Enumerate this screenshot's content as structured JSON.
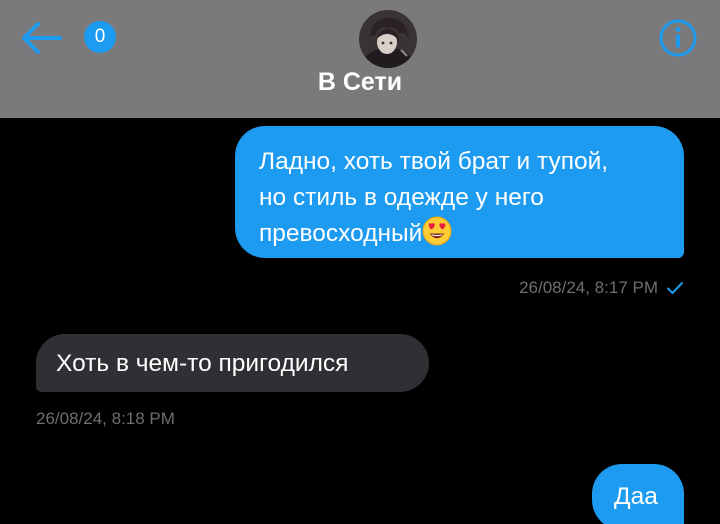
{
  "header": {
    "unread_count": "0",
    "status": "В Сети",
    "back_icon": "arrow-left-icon",
    "info_icon": "info-circle-icon",
    "bar_color": "#7a7a7c",
    "accent_color": "#1d9bf0"
  },
  "messages": [
    {
      "direction": "outgoing",
      "lines": [
        "Ладно, хоть твой брат и тупой,",
        "но стиль в одежде у него",
        "превосходный"
      ],
      "emoji": "smiling-face-with-heart-eyes",
      "timestamp": "26/08/24, 8:17 PM",
      "status_icon": "checkmark-icon"
    },
    {
      "direction": "incoming",
      "text": "Хоть в чем-то пригодился",
      "timestamp": "26/08/24, 8:18 PM"
    },
    {
      "direction": "outgoing",
      "text": "Даа"
    }
  ],
  "colors": {
    "outgoing_bubble": "#1d9bf0",
    "incoming_bubble": "#2f3033",
    "timestamp": "#6e6e73",
    "background": "#000000"
  }
}
